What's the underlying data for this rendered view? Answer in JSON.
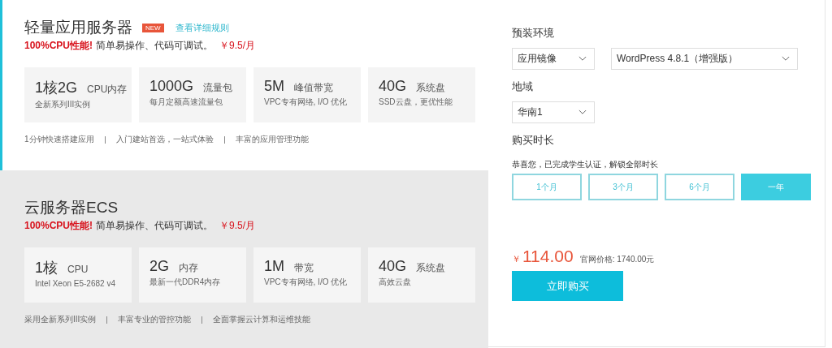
{
  "products": [
    {
      "title": "轻量应用服务器",
      "selected": true,
      "badge": "NEW",
      "link": "查看详细规则",
      "highlight": "100%CPU性能!",
      "description": "简单易操作、代码可调试。",
      "price": "￥9.5/月",
      "specs": [
        {
          "value": "1核2G",
          "label": "CPU内存",
          "detail": "全新系列III实例"
        },
        {
          "value": "1000G",
          "label": "流量包",
          "detail": "每月定额高速流量包"
        },
        {
          "value": "5M",
          "label": "峰值带宽",
          "detail": "VPC专有网络, I/O 优化"
        },
        {
          "value": "40G",
          "label": "系统盘",
          "detail": "SSD云盘，更优性能"
        }
      ],
      "features": [
        "1分钟快速搭建应用",
        "入门建站首选，一站式体验",
        "丰富的应用管理功能"
      ]
    },
    {
      "title": "云服务器ECS",
      "selected": false,
      "highlight": "100%CPU性能!",
      "description": "简单易操作、代码可调试。",
      "price": "￥9.5/月",
      "specs": [
        {
          "value": "1核",
          "label": "CPU",
          "detail": "Intel Xeon E5-2682 v4"
        },
        {
          "value": "2G",
          "label": "内存",
          "detail": "最新一代DDR4内存"
        },
        {
          "value": "1M",
          "label": "带宽",
          "detail": "VPC专有网络, I/O 优化"
        },
        {
          "value": "40G",
          "label": "系统盘",
          "detail": "高效云盘"
        }
      ],
      "features": [
        "采用全新系列III实例",
        "丰富专业的管控功能",
        "全面掌握云计算和运维技能"
      ]
    }
  ],
  "order": {
    "environment_label": "预装环境",
    "environment_selects": [
      {
        "value": "应用镜像"
      },
      {
        "value": "WordPress 4.8.1（增强版）"
      }
    ],
    "region_label": "地域",
    "region_select": {
      "value": "华南1"
    },
    "duration_label": "购买时长",
    "duration_notice": "恭喜您，已完成学生认证，解锁全部时长",
    "durations": [
      {
        "label": "1个月",
        "selected": false
      },
      {
        "label": "3个月",
        "selected": false
      },
      {
        "label": "6个月",
        "selected": false
      },
      {
        "label": "一年",
        "selected": true
      }
    ],
    "currency": "￥",
    "price": "114.00",
    "list_price": "官网价格: 1740.00元",
    "buy_button": "立即购买"
  }
}
